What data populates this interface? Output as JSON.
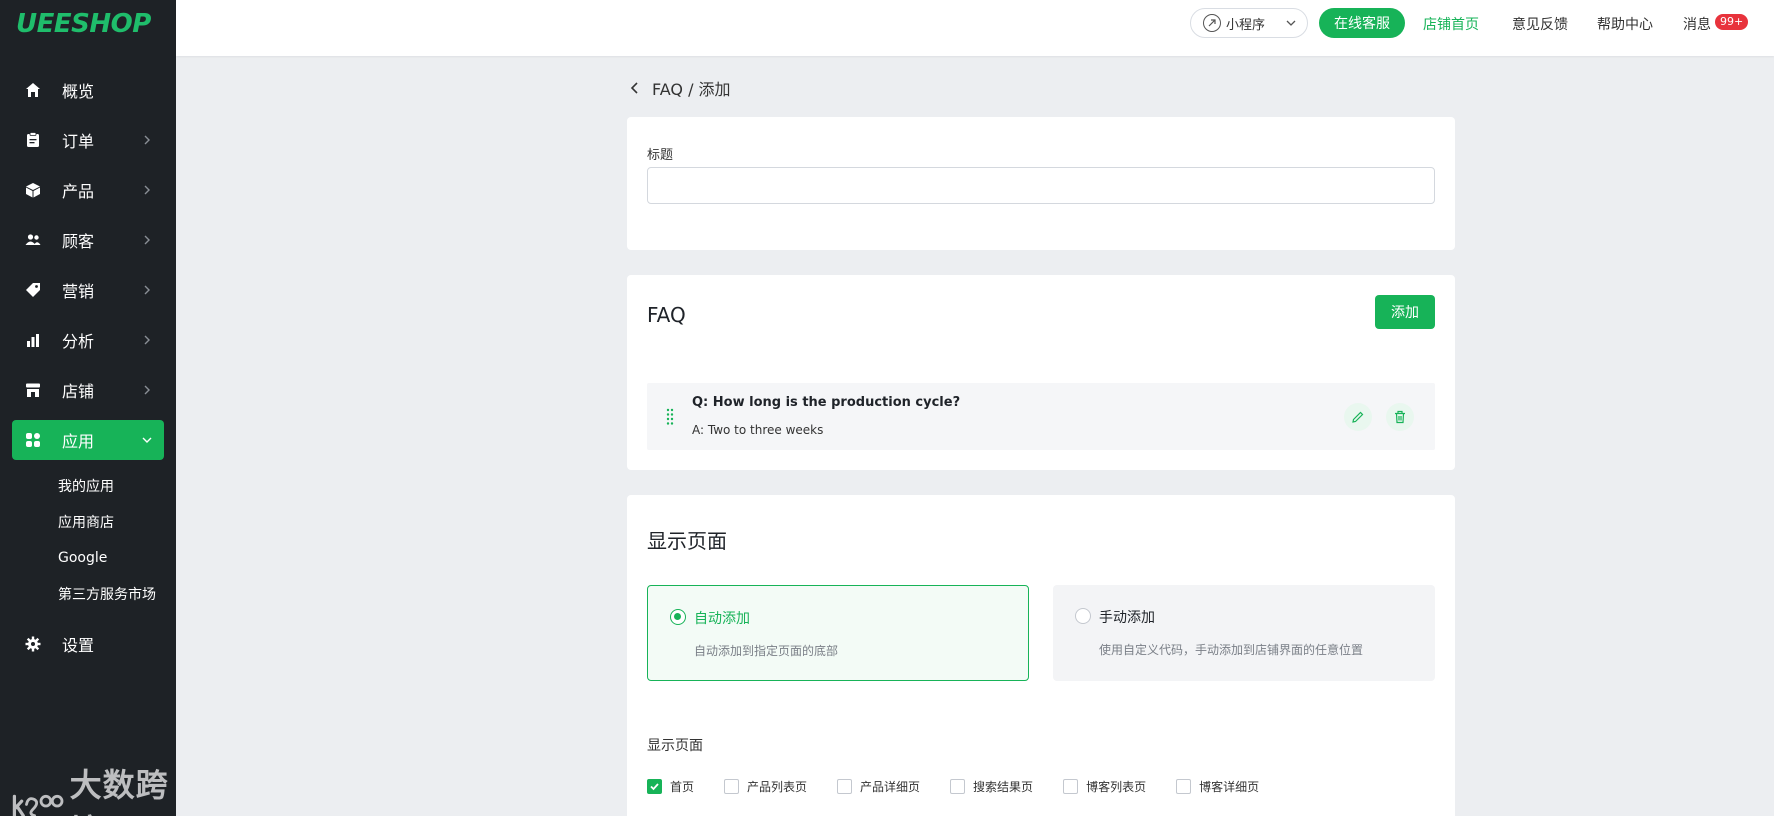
{
  "app": {
    "logo": "UEESHOP"
  },
  "sidebar": {
    "items": [
      {
        "label": "概览",
        "icon": "home-icon"
      },
      {
        "label": "订单",
        "icon": "clipboard-icon"
      },
      {
        "label": "产品",
        "icon": "box-icon"
      },
      {
        "label": "顾客",
        "icon": "users-icon"
      },
      {
        "label": "营销",
        "icon": "tag-icon"
      },
      {
        "label": "分析",
        "icon": "bar-chart-icon"
      },
      {
        "label": "店铺",
        "icon": "store-icon"
      },
      {
        "label": "应用",
        "icon": "apps-icon",
        "active": true
      },
      {
        "label": "设置",
        "icon": "gear-icon"
      }
    ],
    "subitems": [
      "我的应用",
      "应用商店",
      "Google",
      "第三方服务市场"
    ]
  },
  "topbar": {
    "mini_program": "小程序",
    "online_service": "在线客服",
    "store_home": "店铺首页",
    "feedback": "意见反馈",
    "help": "帮助中心",
    "messages": "消息",
    "message_badge": "99+"
  },
  "breadcrumb": "FAQ / 添加",
  "title_field": {
    "label": "标题",
    "value": ""
  },
  "faq": {
    "heading": "FAQ",
    "add_label": "添加",
    "items": [
      {
        "q": "Q: How long is the production cycle?",
        "a": "A: Two to three weeks"
      }
    ]
  },
  "display": {
    "heading": "显示页面",
    "options": [
      {
        "title": "自动添加",
        "desc": "自动添加到指定页面的底部",
        "selected": true
      },
      {
        "title": "手动添加",
        "desc": "使用自定义代码，手动添加到店铺界面的任意位置",
        "selected": false
      }
    ],
    "pages_label": "显示页面",
    "pages": [
      {
        "label": "首页",
        "checked": true
      },
      {
        "label": "产品列表页",
        "checked": false
      },
      {
        "label": "产品详细页",
        "checked": false
      },
      {
        "label": "搜索结果页",
        "checked": false
      },
      {
        "label": "博客列表页",
        "checked": false
      },
      {
        "label": "博客详细页",
        "checked": false
      }
    ]
  },
  "watermark": "大数跨境",
  "colors": {
    "accent": "#17b358",
    "sidebar": "#1e2226",
    "badge": "#e8333c"
  }
}
